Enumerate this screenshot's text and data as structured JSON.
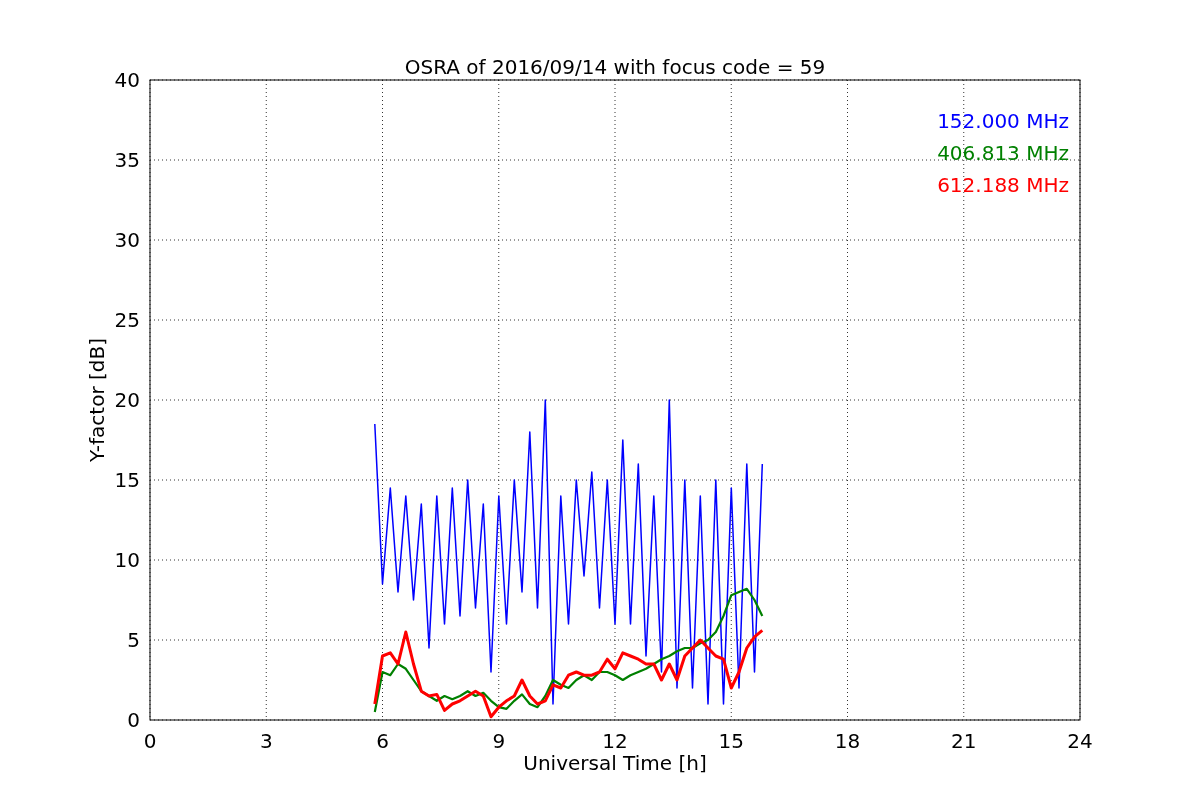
{
  "figure": {
    "chart_data": {
      "type": "line",
      "title": "OSRA of 2016/09/14 with focus code = 59",
      "xlabel": "Universal Time [h]",
      "ylabel": "Y-factor [dB]",
      "x": [
        5.8,
        6.0,
        6.2,
        6.4,
        6.6,
        6.8,
        7.0,
        7.2,
        7.4,
        7.6,
        7.8,
        8.0,
        8.2,
        8.4,
        8.6,
        8.8,
        9.0,
        9.2,
        9.4,
        9.6,
        9.8,
        10.0,
        10.2,
        10.4,
        10.6,
        10.8,
        11.0,
        11.2,
        11.4,
        11.6,
        11.8,
        12.0,
        12.2,
        12.4,
        12.6,
        12.8,
        13.0,
        13.2,
        13.4,
        13.6,
        13.8,
        14.0,
        14.2,
        14.4,
        14.6,
        14.8,
        15.0,
        15.2,
        15.4,
        15.6,
        15.8
      ],
      "series": [
        {
          "name": "152.000 MHz",
          "color": "#0000ff",
          "values": [
            18.5,
            8.5,
            14.5,
            8,
            14,
            7.5,
            13.5,
            4.5,
            14,
            6,
            14.5,
            6.5,
            15,
            7,
            13.5,
            3,
            14,
            6,
            15,
            8,
            18,
            7,
            20,
            1,
            14,
            6,
            15,
            9,
            15.5,
            7,
            15,
            6,
            17.5,
            6,
            16,
            4,
            14,
            3,
            20,
            2,
            15,
            2,
            14,
            1,
            15,
            1,
            14.5,
            2,
            16,
            3,
            16
          ]
        },
        {
          "name": "406.813 MHz",
          "color": "#008000",
          "values": [
            0.5,
            3,
            2.8,
            3.5,
            3.2,
            2.5,
            1.8,
            1.5,
            1.2,
            1.5,
            1.3,
            1.5,
            1.8,
            1.5,
            1.7,
            1.2,
            0.8,
            0.7,
            1.2,
            1.6,
            1.0,
            0.8,
            1.5,
            2.5,
            2.2,
            2.0,
            2.5,
            2.8,
            2.5,
            3.0,
            3.0,
            2.8,
            2.5,
            2.8,
            3.0,
            3.2,
            3.5,
            3.8,
            4.0,
            4.3,
            4.5,
            4.5,
            4.8,
            5.0,
            5.5,
            6.5,
            7.8,
            8.0,
            8.2,
            7.5,
            6.5
          ]
        },
        {
          "name": "612.188 MHz",
          "color": "#ff0000",
          "values": [
            1,
            4,
            4.2,
            3.5,
            5.5,
            3.5,
            1.8,
            1.5,
            1.6,
            0.6,
            1.0,
            1.2,
            1.5,
            1.8,
            1.5,
            0.2,
            0.8,
            1.2,
            1.5,
            2.5,
            1.5,
            1.0,
            1.2,
            2.2,
            2.0,
            2.8,
            3.0,
            2.8,
            2.8,
            3.0,
            3.8,
            3.2,
            4.2,
            4.0,
            3.8,
            3.5,
            3.5,
            2.5,
            3.5,
            2.5,
            4.0,
            4.5,
            5.0,
            4.5,
            4.0,
            3.8,
            2.0,
            3.0,
            4.5,
            5.2,
            5.6
          ]
        }
      ],
      "grid": true,
      "xlim": [
        0,
        24
      ],
      "ylim": [
        0,
        40
      ],
      "xticks": [
        0,
        3,
        6,
        9,
        12,
        15,
        18,
        21,
        24
      ],
      "yticks": [
        0,
        5,
        10,
        15,
        20,
        25,
        30,
        35,
        40
      ]
    }
  }
}
